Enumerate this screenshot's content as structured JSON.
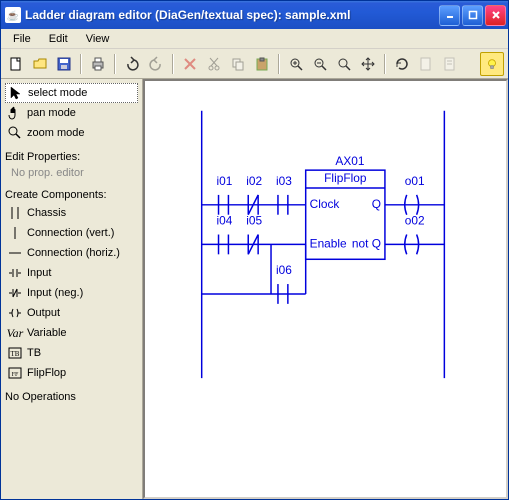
{
  "window": {
    "title": "Ladder diagram editor (DiaGen/textual spec): sample.xml"
  },
  "menu": {
    "file": "File",
    "edit": "Edit",
    "view": "View"
  },
  "sidebar": {
    "modes": {
      "select": "select mode",
      "pan": "pan mode",
      "zoom": "zoom mode"
    },
    "edit_properties_label": "Edit Properties:",
    "no_prop_editor": "No prop. editor",
    "create_components_label": "Create Components:",
    "components": {
      "chassis": "Chassis",
      "conn_vert": "Connection (vert.)",
      "conn_horiz": "Connection (horiz.)",
      "input": "Input",
      "input_neg": "Input (neg.)",
      "output": "Output",
      "variable": "Variable",
      "tb": "TB",
      "flipflop": "FlipFlop"
    },
    "no_operations": "No Operations"
  },
  "diagram": {
    "block": {
      "name": "AX01",
      "type": "FlipFlop",
      "port_clock": "Clock",
      "port_enable": "Enable",
      "port_q": "Q",
      "port_notq": "not Q"
    },
    "inputs": {
      "i01": "i01",
      "i02": "i02",
      "i03": "i03",
      "i04": "i04",
      "i05": "i05",
      "i06": "i06"
    },
    "outputs": {
      "o01": "o01",
      "o02": "o02"
    }
  },
  "icons": {}
}
